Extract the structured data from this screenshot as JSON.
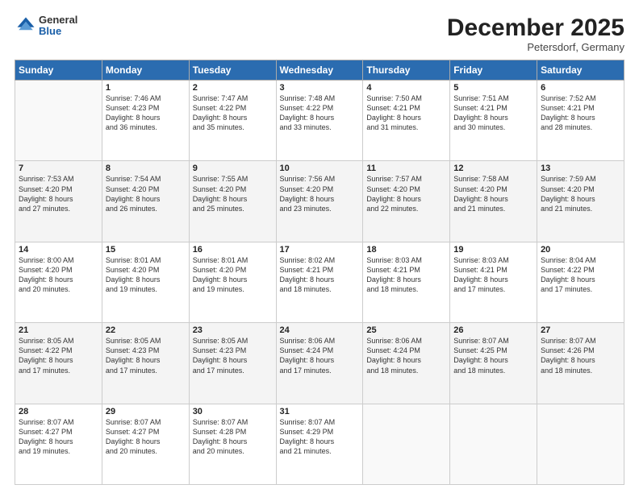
{
  "header": {
    "logo_general": "General",
    "logo_blue": "Blue",
    "month_title": "December 2025",
    "location": "Petersdorf, Germany"
  },
  "days_of_week": [
    "Sunday",
    "Monday",
    "Tuesday",
    "Wednesday",
    "Thursday",
    "Friday",
    "Saturday"
  ],
  "weeks": [
    [
      {
        "day": "",
        "sunrise": "",
        "sunset": "",
        "daylight": "",
        "empty": true
      },
      {
        "day": "1",
        "sunrise": "Sunrise: 7:46 AM",
        "sunset": "Sunset: 4:23 PM",
        "daylight": "Daylight: 8 hours and 36 minutes."
      },
      {
        "day": "2",
        "sunrise": "Sunrise: 7:47 AM",
        "sunset": "Sunset: 4:22 PM",
        "daylight": "Daylight: 8 hours and 35 minutes."
      },
      {
        "day": "3",
        "sunrise": "Sunrise: 7:48 AM",
        "sunset": "Sunset: 4:22 PM",
        "daylight": "Daylight: 8 hours and 33 minutes."
      },
      {
        "day": "4",
        "sunrise": "Sunrise: 7:50 AM",
        "sunset": "Sunset: 4:21 PM",
        "daylight": "Daylight: 8 hours and 31 minutes."
      },
      {
        "day": "5",
        "sunrise": "Sunrise: 7:51 AM",
        "sunset": "Sunset: 4:21 PM",
        "daylight": "Daylight: 8 hours and 30 minutes."
      },
      {
        "day": "6",
        "sunrise": "Sunrise: 7:52 AM",
        "sunset": "Sunset: 4:21 PM",
        "daylight": "Daylight: 8 hours and 28 minutes."
      }
    ],
    [
      {
        "day": "7",
        "sunrise": "Sunrise: 7:53 AM",
        "sunset": "Sunset: 4:20 PM",
        "daylight": "Daylight: 8 hours and 27 minutes."
      },
      {
        "day": "8",
        "sunrise": "Sunrise: 7:54 AM",
        "sunset": "Sunset: 4:20 PM",
        "daylight": "Daylight: 8 hours and 26 minutes."
      },
      {
        "day": "9",
        "sunrise": "Sunrise: 7:55 AM",
        "sunset": "Sunset: 4:20 PM",
        "daylight": "Daylight: 8 hours and 25 minutes."
      },
      {
        "day": "10",
        "sunrise": "Sunrise: 7:56 AM",
        "sunset": "Sunset: 4:20 PM",
        "daylight": "Daylight: 8 hours and 23 minutes."
      },
      {
        "day": "11",
        "sunrise": "Sunrise: 7:57 AM",
        "sunset": "Sunset: 4:20 PM",
        "daylight": "Daylight: 8 hours and 22 minutes."
      },
      {
        "day": "12",
        "sunrise": "Sunrise: 7:58 AM",
        "sunset": "Sunset: 4:20 PM",
        "daylight": "Daylight: 8 hours and 21 minutes."
      },
      {
        "day": "13",
        "sunrise": "Sunrise: 7:59 AM",
        "sunset": "Sunset: 4:20 PM",
        "daylight": "Daylight: 8 hours and 21 minutes."
      }
    ],
    [
      {
        "day": "14",
        "sunrise": "Sunrise: 8:00 AM",
        "sunset": "Sunset: 4:20 PM",
        "daylight": "Daylight: 8 hours and 20 minutes."
      },
      {
        "day": "15",
        "sunrise": "Sunrise: 8:01 AM",
        "sunset": "Sunset: 4:20 PM",
        "daylight": "Daylight: 8 hours and 19 minutes."
      },
      {
        "day": "16",
        "sunrise": "Sunrise: 8:01 AM",
        "sunset": "Sunset: 4:20 PM",
        "daylight": "Daylight: 8 hours and 19 minutes."
      },
      {
        "day": "17",
        "sunrise": "Sunrise: 8:02 AM",
        "sunset": "Sunset: 4:21 PM",
        "daylight": "Daylight: 8 hours and 18 minutes."
      },
      {
        "day": "18",
        "sunrise": "Sunrise: 8:03 AM",
        "sunset": "Sunset: 4:21 PM",
        "daylight": "Daylight: 8 hours and 18 minutes."
      },
      {
        "day": "19",
        "sunrise": "Sunrise: 8:03 AM",
        "sunset": "Sunset: 4:21 PM",
        "daylight": "Daylight: 8 hours and 17 minutes."
      },
      {
        "day": "20",
        "sunrise": "Sunrise: 8:04 AM",
        "sunset": "Sunset: 4:22 PM",
        "daylight": "Daylight: 8 hours and 17 minutes."
      }
    ],
    [
      {
        "day": "21",
        "sunrise": "Sunrise: 8:05 AM",
        "sunset": "Sunset: 4:22 PM",
        "daylight": "Daylight: 8 hours and 17 minutes."
      },
      {
        "day": "22",
        "sunrise": "Sunrise: 8:05 AM",
        "sunset": "Sunset: 4:23 PM",
        "daylight": "Daylight: 8 hours and 17 minutes."
      },
      {
        "day": "23",
        "sunrise": "Sunrise: 8:05 AM",
        "sunset": "Sunset: 4:23 PM",
        "daylight": "Daylight: 8 hours and 17 minutes."
      },
      {
        "day": "24",
        "sunrise": "Sunrise: 8:06 AM",
        "sunset": "Sunset: 4:24 PM",
        "daylight": "Daylight: 8 hours and 17 minutes."
      },
      {
        "day": "25",
        "sunrise": "Sunrise: 8:06 AM",
        "sunset": "Sunset: 4:24 PM",
        "daylight": "Daylight: 8 hours and 18 minutes."
      },
      {
        "day": "26",
        "sunrise": "Sunrise: 8:07 AM",
        "sunset": "Sunset: 4:25 PM",
        "daylight": "Daylight: 8 hours and 18 minutes."
      },
      {
        "day": "27",
        "sunrise": "Sunrise: 8:07 AM",
        "sunset": "Sunset: 4:26 PM",
        "daylight": "Daylight: 8 hours and 18 minutes."
      }
    ],
    [
      {
        "day": "28",
        "sunrise": "Sunrise: 8:07 AM",
        "sunset": "Sunset: 4:27 PM",
        "daylight": "Daylight: 8 hours and 19 minutes."
      },
      {
        "day": "29",
        "sunrise": "Sunrise: 8:07 AM",
        "sunset": "Sunset: 4:27 PM",
        "daylight": "Daylight: 8 hours and 20 minutes."
      },
      {
        "day": "30",
        "sunrise": "Sunrise: 8:07 AM",
        "sunset": "Sunset: 4:28 PM",
        "daylight": "Daylight: 8 hours and 20 minutes."
      },
      {
        "day": "31",
        "sunrise": "Sunrise: 8:07 AM",
        "sunset": "Sunset: 4:29 PM",
        "daylight": "Daylight: 8 hours and 21 minutes."
      },
      {
        "day": "",
        "sunrise": "",
        "sunset": "",
        "daylight": "",
        "empty": true
      },
      {
        "day": "",
        "sunrise": "",
        "sunset": "",
        "daylight": "",
        "empty": true
      },
      {
        "day": "",
        "sunrise": "",
        "sunset": "",
        "daylight": "",
        "empty": true
      }
    ]
  ]
}
